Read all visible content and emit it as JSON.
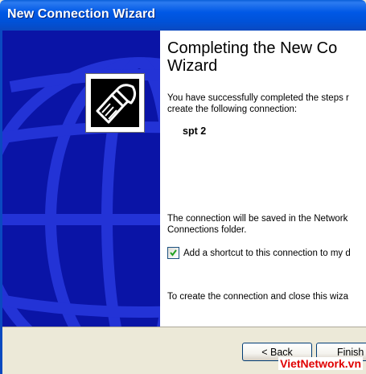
{
  "window": {
    "title": "New Connection Wizard"
  },
  "side_panel": {
    "logo_icon": "network-cable-icon",
    "background_color": "#0a14a6",
    "globe_color": "#1f2fd0"
  },
  "content": {
    "heading": "Completing the New Co\nWizard",
    "intro": "You have successfully completed the steps r\ncreate the following connection:",
    "connection_name": "spt 2",
    "saved_note": "The connection will be saved in the Network\nConnections folder.",
    "shortcut_checkbox": {
      "label": "Add a shortcut to this connection to my d",
      "checked": true
    },
    "close_note": "To create the connection and close this wiza"
  },
  "buttons": {
    "back_label": "< Back",
    "finish_label": "Finish"
  },
  "watermark": "VietNetwork.vn"
}
